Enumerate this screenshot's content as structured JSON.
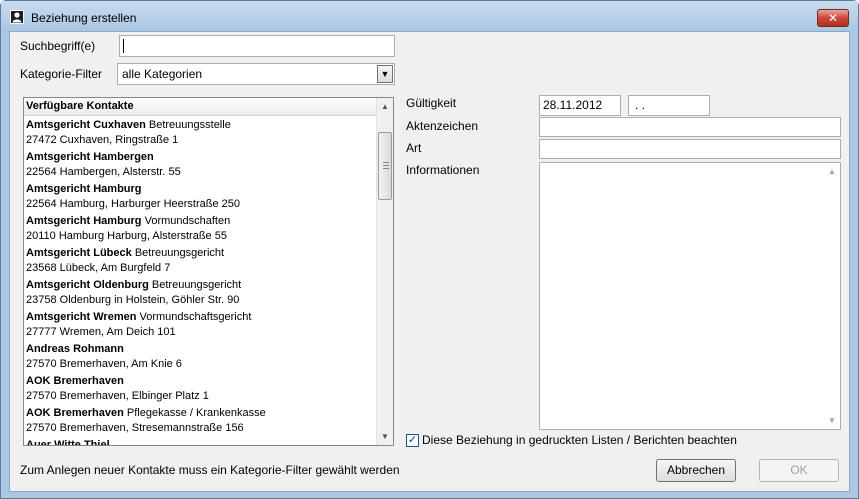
{
  "window": {
    "title": "Beziehung erstellen",
    "close_label": "✕"
  },
  "search": {
    "label": "Suchbegriff(e)",
    "value": ""
  },
  "category_filter": {
    "label": "Kategorie-Filter",
    "selected": "alle Kategorien"
  },
  "contacts": {
    "header": "Verfügbare Kontakte",
    "items": [
      {
        "name": "Amtsgericht Cuxhaven",
        "extra": "Betreuungsstelle",
        "address": "27472 Cuxhaven, Ringstraße 1"
      },
      {
        "name": "Amtsgericht Hambergen",
        "extra": "",
        "address": "22564 Hambergen, Alsterstr. 55"
      },
      {
        "name": "Amtsgericht Hamburg",
        "extra": "",
        "address": "22564 Hamburg, Harburger Heerstraße 250"
      },
      {
        "name": "Amtsgericht Hamburg",
        "extra": "Vormundschaften",
        "address": "20110 Hamburg Harburg, Alsterstraße 55"
      },
      {
        "name": "Amtsgericht Lübeck",
        "extra": "Betreuungsgericht",
        "address": "23568 Lübeck, Am Burgfeld 7"
      },
      {
        "name": "Amtsgericht Oldenburg",
        "extra": "Betreuungsgericht",
        "address": "23758 Oldenburg in Holstein, Göhler Str. 90"
      },
      {
        "name": "Amtsgericht Wremen",
        "extra": "Vormundschaftsgericht",
        "address": "27777 Wremen, Am Deich 101"
      },
      {
        "name": "Andreas Rohmann",
        "extra": "",
        "address": "27570 Bremerhaven, Am Knie 6"
      },
      {
        "name": "AOK Bremerhaven",
        "extra": "",
        "address": "27570 Bremerhaven, Elbinger Platz 1"
      },
      {
        "name": "AOK Bremerhaven",
        "extra": "Pflegekasse / Krankenkasse",
        "address": "27570 Bremerhaven, Stresemannstraße 156"
      },
      {
        "name": "Auer Witte Thiel",
        "extra": "",
        "address": ""
      }
    ]
  },
  "form": {
    "validity_label": "Gültigkeit",
    "validity_from": "28.11.2012",
    "validity_to": " . .",
    "file_number_label": "Aktenzeichen",
    "file_number_value": "",
    "type_label": "Art",
    "type_value": "",
    "info_label": "Informationen",
    "info_value": ""
  },
  "print_checkbox": {
    "label": "Diese Beziehung in gedruckten Listen / Berichten beachten",
    "checked": true
  },
  "hint": "Zum Anlegen neuer Kontakte muss ein Kategorie-Filter gewählt werden",
  "buttons": {
    "cancel": "Abbrechen",
    "ok": "OK"
  }
}
